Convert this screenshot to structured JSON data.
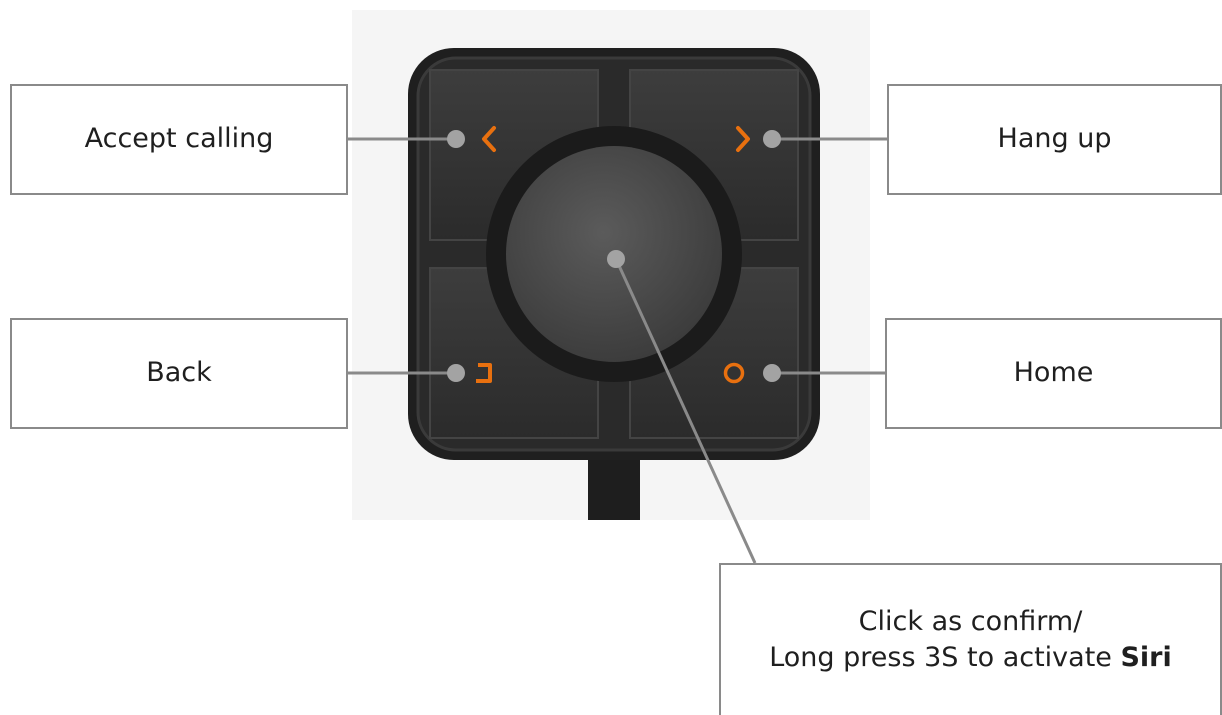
{
  "labels": {
    "accept": "Accept calling",
    "hangup": "Hang up",
    "back": "Back",
    "home": "Home",
    "center_line1": "Click as confirm/",
    "center_line2_prefix": "Long press 3S to activate ",
    "center_line2_bold": "Siri"
  },
  "colors": {
    "accent": "#e8700f",
    "device": "#262626",
    "leader_line": "#8a8a8a"
  },
  "icons": {
    "prev": "chevron-left-icon",
    "next": "chevron-right-icon",
    "back": "back-bracket-icon",
    "home": "ring-icon"
  }
}
